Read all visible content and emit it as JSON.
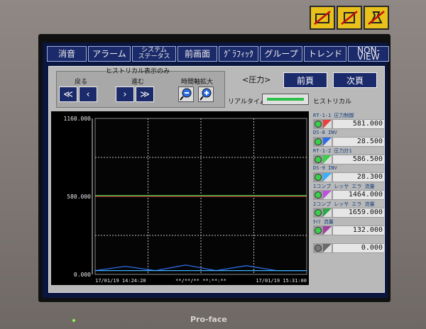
{
  "menu": [
    "消音",
    "アラーム",
    "システム\nステータス",
    "前画面",
    "ｸﾞﾗﾌｨｯｸ",
    "グループ",
    "トレンド",
    "NON-VIEW"
  ],
  "controls": {
    "history_label": "ヒストリカル表示のみ",
    "back_label": "戻る",
    "forward_label": "進む",
    "zoom_label": "時間軸拡大",
    "page_title": "<圧力>",
    "prev_page": "前頁",
    "next_page": "次頁",
    "realtime_label": "リアルタイム",
    "historical_label": "ヒストリカル",
    "back_fast": "≪",
    "back_one": "‹",
    "fwd_one": "›",
    "fwd_fast": "≫"
  },
  "chart_data": {
    "type": "line",
    "y_tick_labels": [
      "1160.000",
      "580.000",
      "0.000"
    ],
    "ylim": [
      0,
      1160
    ],
    "x_tick_labels": [
      "17/01/19 14:24:20",
      "**/**/** **:**:**",
      "17/01/19 15:31:00"
    ],
    "grid": true,
    "series": [
      {
        "name": "RT-1-1 圧力制御",
        "color": "#e84040",
        "values": [
          581,
          581,
          581,
          581,
          581,
          581,
          581,
          581
        ]
      },
      {
        "name": "RT-1-2 圧力計1",
        "color": "#39d049",
        "values": [
          586.5,
          586.5,
          586.5,
          586.5,
          586.5,
          586.5,
          586.5,
          586.5
        ]
      },
      {
        "name": "DS-8 INV",
        "color": "#2d6ee8",
        "values": [
          28.5,
          60,
          28.5,
          70,
          28.5,
          65,
          28.5,
          28.5
        ]
      },
      {
        "name": "DS-9 INV",
        "color": "#39b0ff",
        "values": [
          28.3,
          28.3,
          28.3,
          28.3,
          28.3,
          28.3,
          28.3,
          28.3
        ]
      }
    ]
  },
  "legend": [
    {
      "title": "RT-1-1 圧力制御",
      "value": "581.000",
      "color": "#e84040"
    },
    {
      "title": "DS-8 INV",
      "value": "28.500",
      "color": "#2d6ee8"
    },
    {
      "title": "RT-1-2 圧力計1",
      "value": "586.500",
      "color": "#39d049"
    },
    {
      "title": "DS-9 INV",
      "value": "28.300",
      "color": "#39b0ff"
    },
    {
      "title": "1コンプ レッサ エラ 流量",
      "value": "1464.000",
      "color": "#c050e0"
    },
    {
      "title": "2コンプ レッサ エラ 流量",
      "value": "1659.000",
      "color": "#2fa84a"
    },
    {
      "title": "ﾀｲﾏ 流量",
      "value": "132.000",
      "color": "#a040a0"
    },
    {
      "title": "",
      "value": "0.000",
      "color": "#6a6a6a"
    }
  ],
  "brand": "Pro-face"
}
